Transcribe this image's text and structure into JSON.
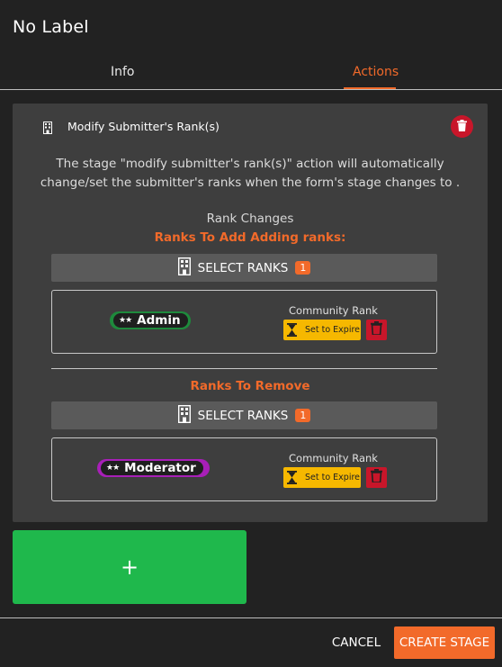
{
  "header": {
    "title": "No Label"
  },
  "tabs": [
    {
      "label": "Info",
      "active": false
    },
    {
      "label": "Actions",
      "active": true
    }
  ],
  "action_card": {
    "title": "Modify Submitter's Rank(s)",
    "description": "The stage \"modify submitter's rank(s)\" action will automatically change/set the submitter's ranks when the form's stage changes to .",
    "rank_changes_label": "Rank Changes",
    "add_section": {
      "heading": "Ranks To Add Adding ranks:",
      "select_label": "SELECT RANKS",
      "count": "1",
      "ranks": [
        {
          "name": "Admin",
          "stars": "★★",
          "rank_type": "Community Rank",
          "expire_label": "Set to Expire",
          "pill_color": "#1e8a3c"
        }
      ]
    },
    "remove_section": {
      "heading": "Ranks To Remove",
      "select_label": "SELECT RANKS",
      "count": "1",
      "ranks": [
        {
          "name": "Moderator",
          "stars": "★★",
          "rank_type": "Community Rank",
          "expire_label": "Set to Expire",
          "pill_color": "#a81fb8"
        }
      ]
    }
  },
  "add_button": {
    "label": "+"
  },
  "footer": {
    "cancel_label": "CANCEL",
    "create_label": "CREATE STAGE"
  },
  "colors": {
    "accent": "#f26a2a",
    "success": "#1fb84c",
    "danger": "#c8162a",
    "warning": "#f6b800"
  },
  "icons": {
    "delete": "trash-icon",
    "building": "building-icon",
    "hourglass": "hourglass-icon"
  }
}
